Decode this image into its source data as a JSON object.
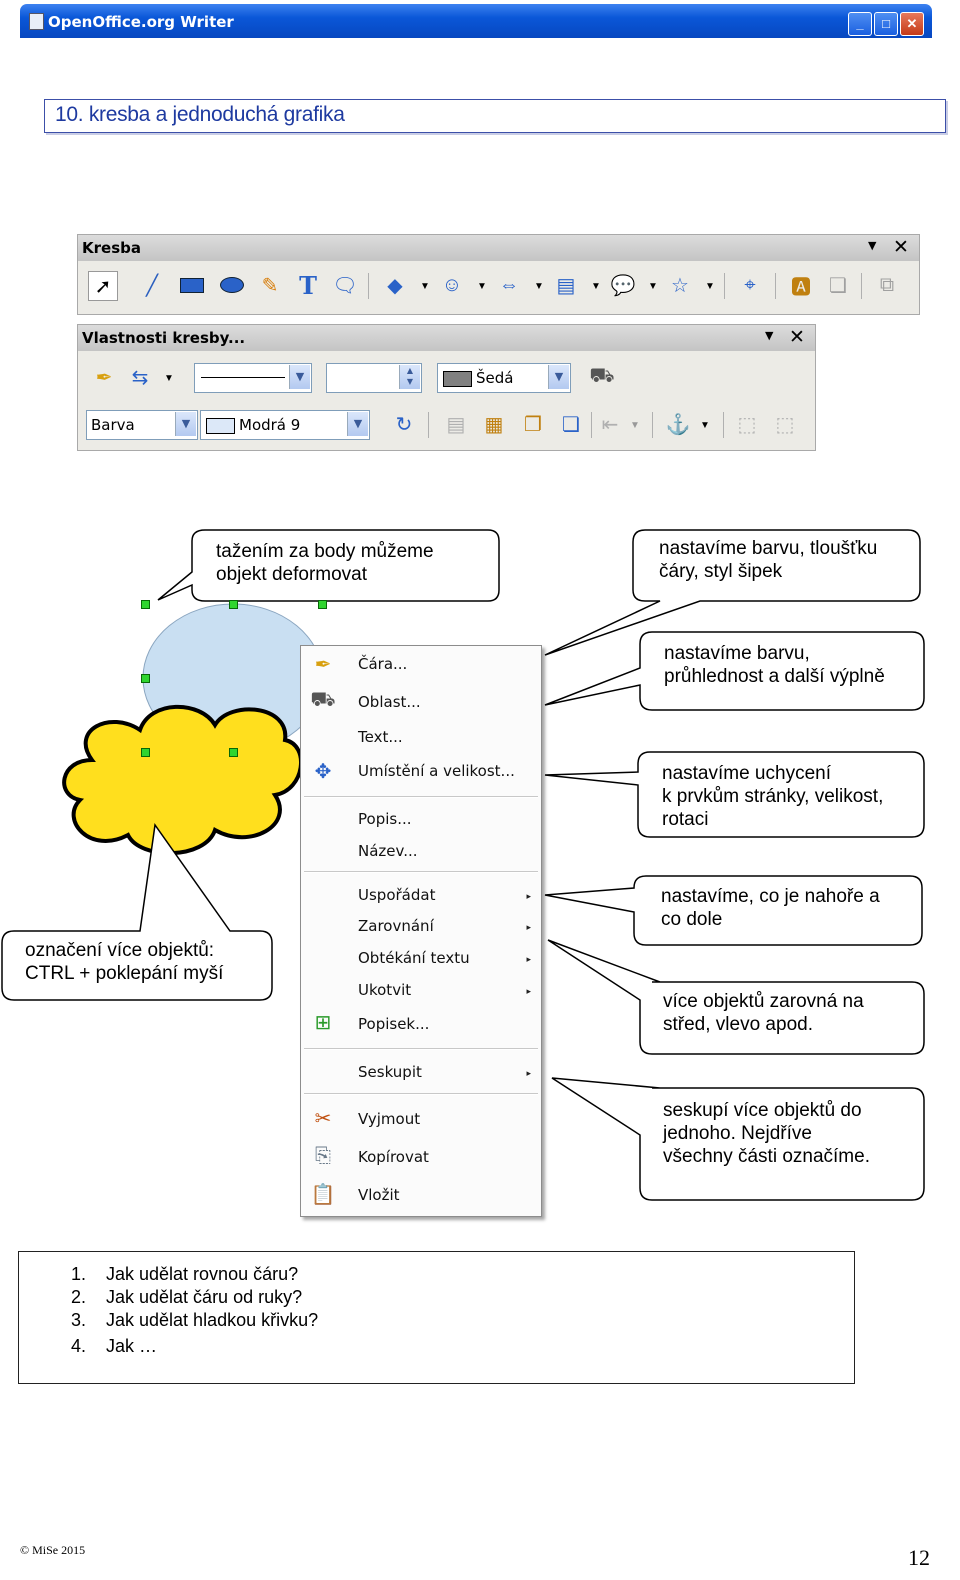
{
  "window": {
    "title": "OpenOffice.org Writer",
    "min": "_",
    "max": "□",
    "close": "✕"
  },
  "heading": "10. kresba a jednoduchá grafika",
  "toolbar_kresba": {
    "title": "Kresba"
  },
  "toolbar_props": {
    "title": "Vlastnosti kresby...",
    "line_width": "",
    "line_color": "Šedá",
    "area_style": "Barva",
    "area_color": "Modrá 9"
  },
  "callouts": {
    "deform": "tažením za body  můžeme\nobjekt deformovat",
    "line": "nastavíme barvu, tloušťku\nčáry, styl šipek",
    "area": "nastavíme barvu,\nprůhlednost a další výplně",
    "position": "nastavíme uchycení\nk prvkům stránky, velikost,\nrotaci",
    "arrange": "nastavíme, co je nahoře a\nco dole",
    "align": "více objektů zarovná na\nstřed, vlevo apod.",
    "group": "seskupí více objektů do\njednoho. Nejdříve\nvšechny části označíme.",
    "select": "označení více objektů:\nCTRL + poklepání myší"
  },
  "menu": {
    "items": [
      {
        "label": "Čára...",
        "icon": "line-pen-icon"
      },
      {
        "label": "Oblast...",
        "icon": "paint-bucket-icon"
      },
      {
        "label": "Text...",
        "icon": ""
      },
      {
        "label": "Umístění a velikost...",
        "icon": "position-size-icon"
      },
      {
        "label": "Popis...",
        "icon": ""
      },
      {
        "label": "Název...",
        "icon": ""
      },
      {
        "label": "Uspořádat",
        "icon": ""
      },
      {
        "label": "Zarovnání",
        "icon": ""
      },
      {
        "label": "Obtékání textu",
        "icon": ""
      },
      {
        "label": "Ukotvit",
        "icon": ""
      },
      {
        "label": "Popisek...",
        "icon": "caption-icon"
      },
      {
        "label": "Seskupit",
        "icon": ""
      },
      {
        "label": "Vyjmout",
        "icon": "scissors-icon"
      },
      {
        "label": "Kopírovat",
        "icon": "copy-icon"
      },
      {
        "label": "Vložit",
        "icon": "paste-icon"
      }
    ],
    "submenu_arrow": "▸"
  },
  "questions": [
    {
      "num": "1.",
      "text": "Jak udělat rovnou čáru?"
    },
    {
      "num": "2.",
      "text": "Jak udělat čáru od ruky?"
    },
    {
      "num": "3.",
      "text": "Jak udělat hladkou křivku?"
    },
    {
      "num": "4.",
      "text": "Jak …"
    }
  ],
  "footer": {
    "copyright": "© MiSe 2015",
    "page": "12"
  },
  "colors": {
    "title_bar": "#0a57d8",
    "heading_border": "#3c4fa8",
    "ellipse": "#c9dff2",
    "cloud": "#ffdf1e",
    "handles": "#2fd52f"
  }
}
